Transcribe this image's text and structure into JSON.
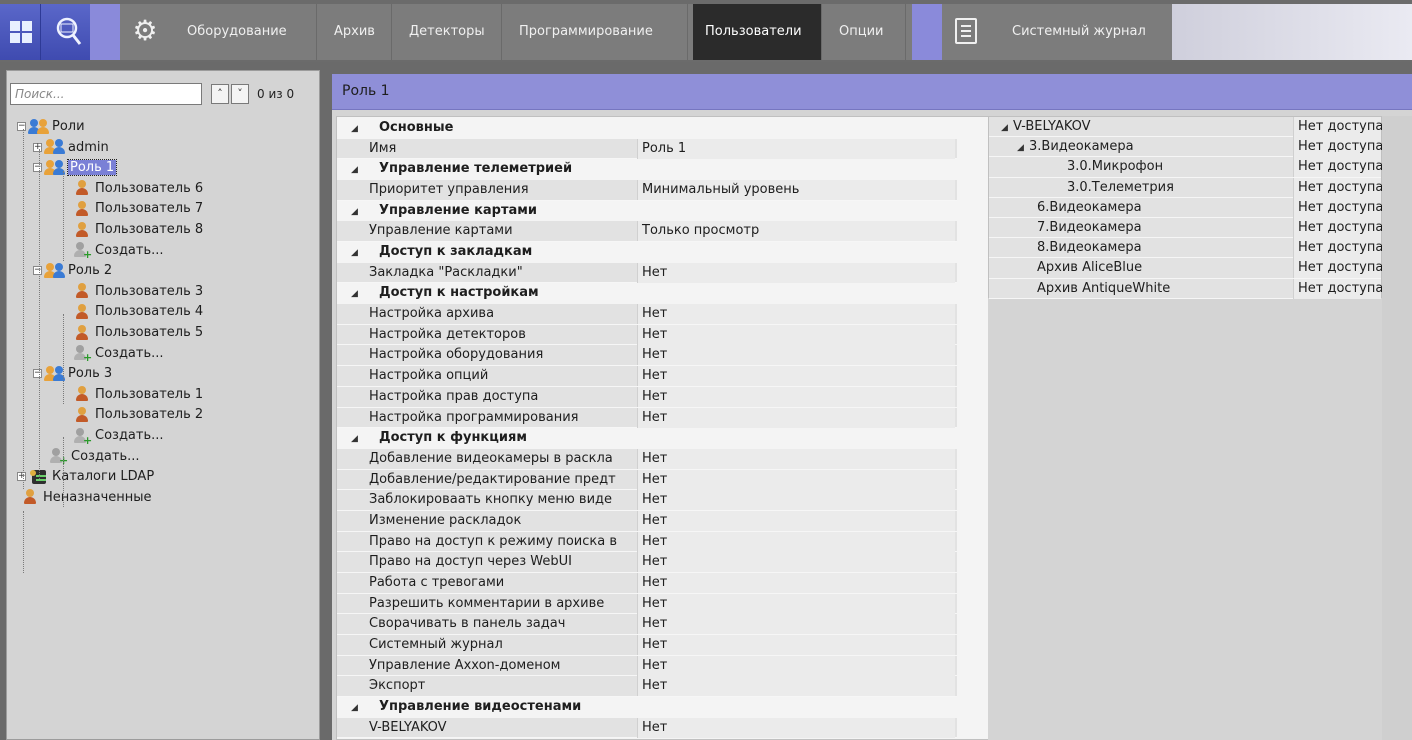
{
  "toolbar": {
    "menu": [
      {
        "label": "Оборудование",
        "active": false
      },
      {
        "label": "Архив",
        "active": false
      },
      {
        "label": "Детекторы",
        "active": false
      },
      {
        "label": "Программирование",
        "active": false
      },
      {
        "label": "Пользователи",
        "active": true
      },
      {
        "label": "Опции",
        "active": false
      }
    ],
    "log_label": "Системный журнал",
    "icons": [
      "windows-icon",
      "search-icon",
      "gear-icon",
      "log-icon"
    ]
  },
  "left": {
    "search_placeholder": "Поиск...",
    "prev_label": "˄",
    "next_label": "˅",
    "count": "0 из 0",
    "tree": [
      {
        "label": "Роли",
        "level": 0,
        "icon": "roles",
        "exp": "−"
      },
      {
        "label": "admin",
        "level": 1,
        "icon": "role",
        "exp": "+"
      },
      {
        "label": "Роль 1",
        "level": 1,
        "icon": "role",
        "exp": "−",
        "selected": true
      },
      {
        "label": "Пользователь 6",
        "level": 2,
        "icon": "user"
      },
      {
        "label": "Пользователь 7",
        "level": 2,
        "icon": "user"
      },
      {
        "label": "Пользователь 8",
        "level": 2,
        "icon": "user"
      },
      {
        "label": "Создать...",
        "level": 2,
        "icon": "create"
      },
      {
        "label": "Роль 2",
        "level": 1,
        "icon": "role",
        "exp": "−"
      },
      {
        "label": "Пользователь 3",
        "level": 2,
        "icon": "user"
      },
      {
        "label": "Пользователь 4",
        "level": 2,
        "icon": "user"
      },
      {
        "label": "Пользователь 5",
        "level": 2,
        "icon": "user"
      },
      {
        "label": "Создать...",
        "level": 2,
        "icon": "create"
      },
      {
        "label": "Роль 3",
        "level": 1,
        "icon": "role",
        "exp": "−"
      },
      {
        "label": "Пользователь 1",
        "level": 2,
        "icon": "user"
      },
      {
        "label": "Пользователь 2",
        "level": 2,
        "icon": "user"
      },
      {
        "label": "Создать...",
        "level": 2,
        "icon": "create"
      },
      {
        "label": "Создать...",
        "level": 1,
        "icon": "create"
      },
      {
        "label": "Каталоги LDAP",
        "level": 0,
        "icon": "ldap",
        "exp": "+"
      },
      {
        "label": "Неназначенные",
        "level": 0,
        "icon": "user"
      }
    ]
  },
  "main": {
    "title": "Роль 1",
    "properties": [
      {
        "type": "cat",
        "name": "Основные"
      },
      {
        "type": "item",
        "name": "Имя",
        "value": "Роль 1"
      },
      {
        "type": "cat",
        "name": "Управление телеметрией"
      },
      {
        "type": "item",
        "name": "Приоритет управления",
        "value": "Минимальный уровень"
      },
      {
        "type": "cat",
        "name": "Управление картами"
      },
      {
        "type": "item",
        "name": "Управление картами",
        "value": "Только просмотр"
      },
      {
        "type": "cat",
        "name": "Доступ к закладкам"
      },
      {
        "type": "item",
        "name": "Закладка \"Раскладки\"",
        "value": "Нет"
      },
      {
        "type": "cat",
        "name": "Доступ к настройкам"
      },
      {
        "type": "item",
        "name": "Настройка архива",
        "value": "Нет"
      },
      {
        "type": "item",
        "name": "Настройка детекторов",
        "value": "Нет"
      },
      {
        "type": "item",
        "name": "Настройка оборудования",
        "value": "Нет"
      },
      {
        "type": "item",
        "name": "Настройка опций",
        "value": "Нет"
      },
      {
        "type": "item",
        "name": "Настройка прав доступа",
        "value": "Нет"
      },
      {
        "type": "item",
        "name": "Настройка программирования",
        "value": "Нет"
      },
      {
        "type": "cat",
        "name": "Доступ к функциям"
      },
      {
        "type": "item",
        "name": "Добавление видеокамеры в раскла",
        "value": "Нет"
      },
      {
        "type": "item",
        "name": "Добавление/редактирование предт",
        "value": "Нет"
      },
      {
        "type": "item",
        "name": "Заблокироваать кнопку меню виде",
        "value": "Нет"
      },
      {
        "type": "item",
        "name": "Изменение раскладок",
        "value": "Нет"
      },
      {
        "type": "item",
        "name": "Право на доступ к режиму поиска в",
        "value": "Нет"
      },
      {
        "type": "item",
        "name": "Право на доступ через WebUI",
        "value": "Нет"
      },
      {
        "type": "item",
        "name": "Работа с тревогами",
        "value": "Нет"
      },
      {
        "type": "item",
        "name": "Разрешить комментарии в архиве",
        "value": "Нет"
      },
      {
        "type": "item",
        "name": "Сворачивать в панель задач",
        "value": "Нет"
      },
      {
        "type": "item",
        "name": "Системный журнал",
        "value": "Нет"
      },
      {
        "type": "item",
        "name": "Управление Axxon-доменом",
        "value": "Нет"
      },
      {
        "type": "item",
        "name": "Экспорт",
        "value": "Нет"
      },
      {
        "type": "cat",
        "name": "Управление видеостенами"
      },
      {
        "type": "item",
        "name": "V-BELYAKOV",
        "value": "Нет"
      }
    ],
    "access": [
      {
        "name": "V-BELYAKOV",
        "level": 0,
        "tri": "◢",
        "value": "Нет доступа"
      },
      {
        "name": "3.Видеокамера",
        "level": 1,
        "tri": "◢",
        "value": "Нет доступа"
      },
      {
        "name": "3.0.Микрофон",
        "level": 2,
        "value": "Нет доступа"
      },
      {
        "name": "3.0.Телеметрия",
        "level": 2,
        "value": "Нет доступа"
      },
      {
        "name": "6.Видеокамера",
        "level": 1,
        "value": "Нет доступа"
      },
      {
        "name": "7.Видеокамера",
        "level": 1,
        "value": "Нет доступа"
      },
      {
        "name": "8.Видеокамера",
        "level": 1,
        "value": "Нет доступа"
      },
      {
        "name": "Архив AliceBlue",
        "level": 1,
        "value": "Нет доступа"
      },
      {
        "name": "Архив AntiqueWhite",
        "level": 1,
        "value": "Нет доступа"
      }
    ]
  },
  "colors": {
    "accent": "#8f8fd8",
    "selection": "#7a80d6",
    "toolbar": "#7c7c7c",
    "active_tab": "#2b2b2b"
  }
}
